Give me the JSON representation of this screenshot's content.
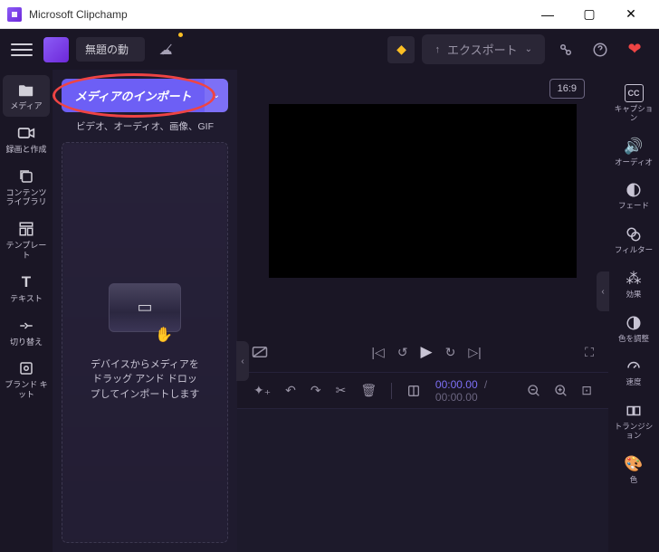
{
  "titlebar": {
    "appName": "Microsoft Clipchamp"
  },
  "toolbar": {
    "projectName": "無題の動",
    "exportLabel": "エクスポート"
  },
  "leftNav": [
    {
      "icon": "folder",
      "label": "メディア",
      "name": "nav-media",
      "active": true
    },
    {
      "icon": "camera",
      "label": "録画と作成",
      "name": "nav-record"
    },
    {
      "icon": "library",
      "label": "コンテンツ ライブラリ",
      "name": "nav-library"
    },
    {
      "icon": "template",
      "label": "テンプレート",
      "name": "nav-templates"
    },
    {
      "icon": "text",
      "label": "テキスト",
      "name": "nav-text"
    },
    {
      "icon": "transition",
      "label": "切り替え",
      "name": "nav-transition"
    },
    {
      "icon": "brand",
      "label": "ブランド キット",
      "name": "nav-brand"
    }
  ],
  "mediaPanel": {
    "importLabel": "メディアのインポート",
    "subtitle": "ビデオ、オーディオ、画像、GIF",
    "dropText1": "デバイスからメディアを",
    "dropText2": "ドラッグ アンド ドロッ",
    "dropText3": "プしてインポートします"
  },
  "preview": {
    "aspectLabel": "16:9"
  },
  "timeline": {
    "current": "00:00.00",
    "total": "00:00.00"
  },
  "rightNav": [
    {
      "icon": "cc",
      "label": "キャプション",
      "name": "r-captions"
    },
    {
      "icon": "audio",
      "label": "オーディオ",
      "name": "r-audio"
    },
    {
      "icon": "fade",
      "label": "フェード",
      "name": "r-fade"
    },
    {
      "icon": "filter",
      "label": "フィルター",
      "name": "r-filter"
    },
    {
      "icon": "fx",
      "label": "効果",
      "name": "r-effects"
    },
    {
      "icon": "adjust",
      "label": "色を調整",
      "name": "r-color"
    },
    {
      "icon": "speed",
      "label": "速度",
      "name": "r-speed"
    },
    {
      "icon": "trans",
      "label": "トランジション",
      "name": "r-rtrans"
    },
    {
      "icon": "palette",
      "label": "色",
      "name": "r-palette"
    }
  ]
}
